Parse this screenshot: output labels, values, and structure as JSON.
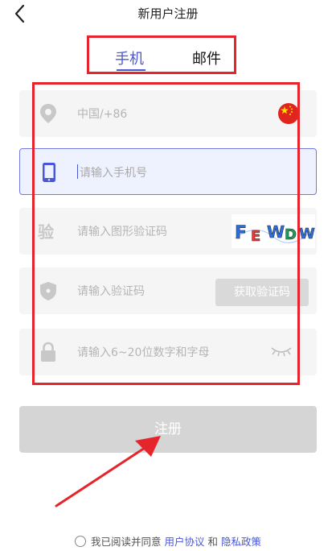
{
  "header": {
    "title": "新用户注册",
    "back_icon": "chevron-left-icon"
  },
  "tabs": [
    {
      "label": "手机",
      "active": true
    },
    {
      "label": "邮件",
      "active": false
    }
  ],
  "fields": {
    "region": {
      "placeholder": "中国/+86",
      "icon": "location-pin-icon",
      "flag": "china-flag-icon"
    },
    "phone": {
      "placeholder": "请输入手机号",
      "icon": "phone-icon"
    },
    "captcha": {
      "placeholder": "请输入图形验证码",
      "icon_text": "验",
      "captcha_text": "FEWDW"
    },
    "sms_code": {
      "placeholder": "请输入验证码",
      "icon": "shield-icon",
      "button_label": "获取验证码"
    },
    "password": {
      "placeholder": "请输入6~20位数字和字母",
      "icon": "lock-icon",
      "toggle_icon": "eye-closed-icon"
    }
  },
  "register_button": {
    "label": "注册"
  },
  "agreement": {
    "prefix": "我已阅读并同意",
    "user_agreement": "用户协议",
    "and": "和",
    "privacy_policy": "隐私政策"
  },
  "colors": {
    "accent": "#4a57d8",
    "annotation": "#e5242b",
    "field_bg": "#f5f5f5",
    "disabled": "#d5d5d5"
  }
}
